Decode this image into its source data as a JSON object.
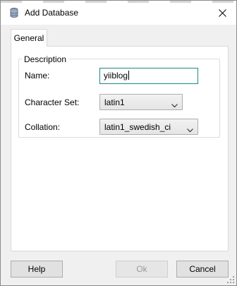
{
  "window": {
    "title": "Add Database",
    "icons": {
      "app": "database-icon",
      "close": "close-icon",
      "resize": "resize-grip-icon"
    }
  },
  "tabs": [
    {
      "label": "General",
      "selected": true
    }
  ],
  "description_group": {
    "legend": "Description",
    "name": {
      "label": "Name:",
      "value": "yiiblog"
    },
    "character_set": {
      "label": "Character Set:",
      "value": "latin1"
    },
    "collation": {
      "label": "Collation:",
      "value": "latin1_swedish_ci"
    }
  },
  "buttons": {
    "help": "Help",
    "ok": "Ok",
    "ok_enabled": false,
    "cancel": "Cancel"
  },
  "colors": {
    "window_bg": "#f0f0f0",
    "panel_bg": "#ffffff",
    "focus_border": "#1a8a84",
    "disabled_text": "#9a9a9a"
  }
}
